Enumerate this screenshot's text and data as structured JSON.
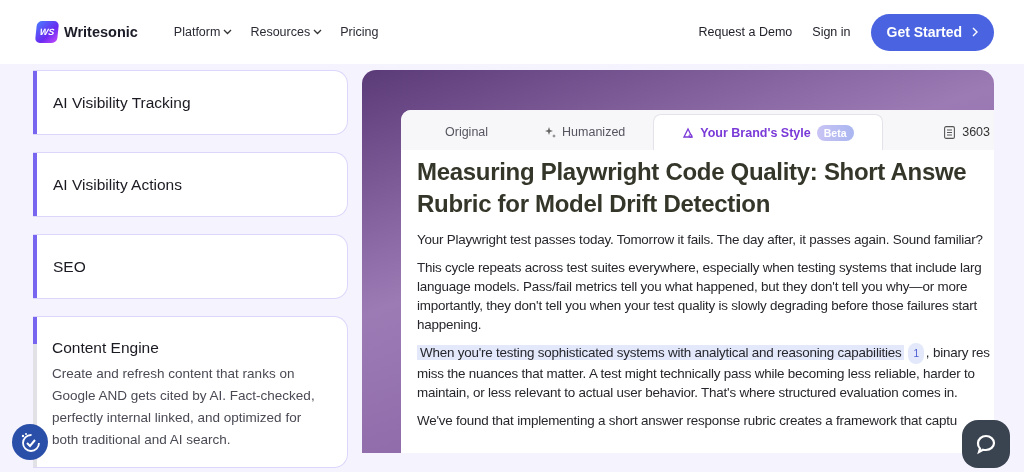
{
  "header": {
    "brand": "Writesonic",
    "logo_text": "WS",
    "nav": [
      {
        "label": "Platform",
        "dropdown": true
      },
      {
        "label": "Resources",
        "dropdown": true
      },
      {
        "label": "Pricing",
        "dropdown": false
      }
    ],
    "actions": [
      {
        "label": "Request a Demo",
        "kind": "link"
      },
      {
        "label": "Sign in",
        "kind": "link"
      },
      {
        "label": "Get Started",
        "kind": "primary"
      }
    ]
  },
  "features": [
    {
      "title": "AI Visibility Tracking",
      "expanded": false,
      "level": 1
    },
    {
      "title": "AI Visibility Actions",
      "expanded": false,
      "level": 1
    },
    {
      "title": "SEO",
      "expanded": false,
      "level": 1
    },
    {
      "title": "Content Engine",
      "expanded": true,
      "level": 0.18,
      "description": "Create and refresh content that ranks on Google AND gets cited by AI. Fact-checked, perfectly internal linked, and optimized for both traditional and AI search."
    }
  ],
  "editor": {
    "tabs": [
      {
        "label": "Original",
        "selected": false
      },
      {
        "label": "Humanized",
        "selected": false
      },
      {
        "label": "Your Brand's Style",
        "selected": true,
        "badge": "Beta"
      }
    ],
    "word_count": "3603",
    "heading_lines": [
      "Measuring Playwright Code Quality: Short Answe",
      "Rubric for Model Drift Detection"
    ],
    "paragraphs": [
      {
        "kind": "plain",
        "text": "Your Playwright test passes today. Tomorrow it fails. The day after, it passes again. Sound familiar?"
      },
      {
        "kind": "plain",
        "text": "This cycle repeats across test suites everywhere, especially when testing systems that include larg language models. Pass/fail metrics tell you what happened, but they don't tell you why—or more importantly, they don't tell you when your test quality is slowly degrading before those failures start happening."
      },
      {
        "kind": "cited",
        "highlight": "When you're testing sophisticated systems with analytical and reasoning capabilities",
        "citation": "1",
        "text": ", binary res miss the nuances that matter. A test might technically pass while becoming less reliable, harder to maintain, or less relevant to actual user behavior. That's where structured evaluation comes in."
      },
      {
        "kind": "plain",
        "text": "We've found that implementing a short answer response rubric creates a framework that captu"
      }
    ]
  }
}
